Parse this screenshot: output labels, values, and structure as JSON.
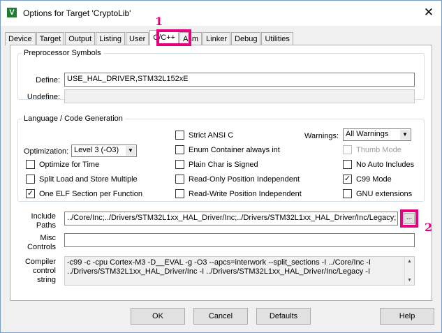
{
  "window": {
    "title": "Options for Target 'CryptoLib'",
    "app_icon": "V",
    "close_glyph": "✕"
  },
  "tabs": [
    {
      "label": "Device"
    },
    {
      "label": "Target"
    },
    {
      "label": "Output"
    },
    {
      "label": "Listing"
    },
    {
      "label": "User"
    },
    {
      "label": "C/C++",
      "active": true
    },
    {
      "label": "Asm"
    },
    {
      "label": "Linker"
    },
    {
      "label": "Debug"
    },
    {
      "label": "Utilities"
    }
  ],
  "annotations": {
    "tab_marker": "1",
    "browse_marker": "2",
    "color": "#e5007e"
  },
  "preprocessor": {
    "legend": "Preprocessor Symbols",
    "define_label": "Define:",
    "define_value": "USE_HAL_DRIVER,STM32L152xE",
    "undefine_label": "Undefine:",
    "undefine_value": ""
  },
  "language": {
    "legend": "Language / Code Generation",
    "optimization_label": "Optimization:",
    "optimization_value": "Level 3 (-O3)",
    "warnings_label": "Warnings:",
    "warnings_value": "All Warnings",
    "checkboxes": {
      "optimize_time": {
        "label": "Optimize for Time",
        "checked": false
      },
      "split_load": {
        "label": "Split Load and Store Multiple",
        "checked": false
      },
      "one_elf": {
        "label": "One ELF Section per Function",
        "checked": true
      },
      "strict_ansi": {
        "label": "Strict ANSI C",
        "checked": false
      },
      "enum_container": {
        "label": "Enum Container always int",
        "checked": false
      },
      "plain_char": {
        "label": "Plain Char is Signed",
        "checked": false
      },
      "ro_pi": {
        "label": "Read-Only Position Independent",
        "checked": false
      },
      "rw_pi": {
        "label": "Read-Write Position Independent",
        "checked": false
      },
      "thumb_mode": {
        "label": "Thumb Mode",
        "checked": false,
        "disabled": true
      },
      "no_auto_includes": {
        "label": "No Auto Includes",
        "checked": false
      },
      "c99_mode": {
        "label": "C99 Mode",
        "checked": true
      },
      "gnu_ext": {
        "label": "GNU extensions",
        "checked": false
      }
    }
  },
  "include": {
    "label_line1": "Include",
    "label_line2": "Paths",
    "value": "../Core/Inc;../Drivers/STM32L1xx_HAL_Driver/Inc;../Drivers/STM32L1xx_HAL_Driver/Inc/Legacy;",
    "browse_label": "..."
  },
  "misc": {
    "label_line1": "Misc",
    "label_line2": "Controls",
    "value": ""
  },
  "compiler": {
    "label_line1": "Compiler",
    "label_line2": "control",
    "label_line3": "string",
    "line1": "-c99 -c -cpu Cortex-M3 -D__EVAL -g -O3 --apcs=interwork --split_sections -I ../Core/Inc -I",
    "line2": "../Drivers/STM32L1xx_HAL_Driver/Inc -I ../Drivers/STM32L1xx_HAL_Driver/Inc/Legacy -I"
  },
  "buttons": {
    "ok": "OK",
    "cancel": "Cancel",
    "defaults": "Defaults",
    "help": "Help"
  }
}
